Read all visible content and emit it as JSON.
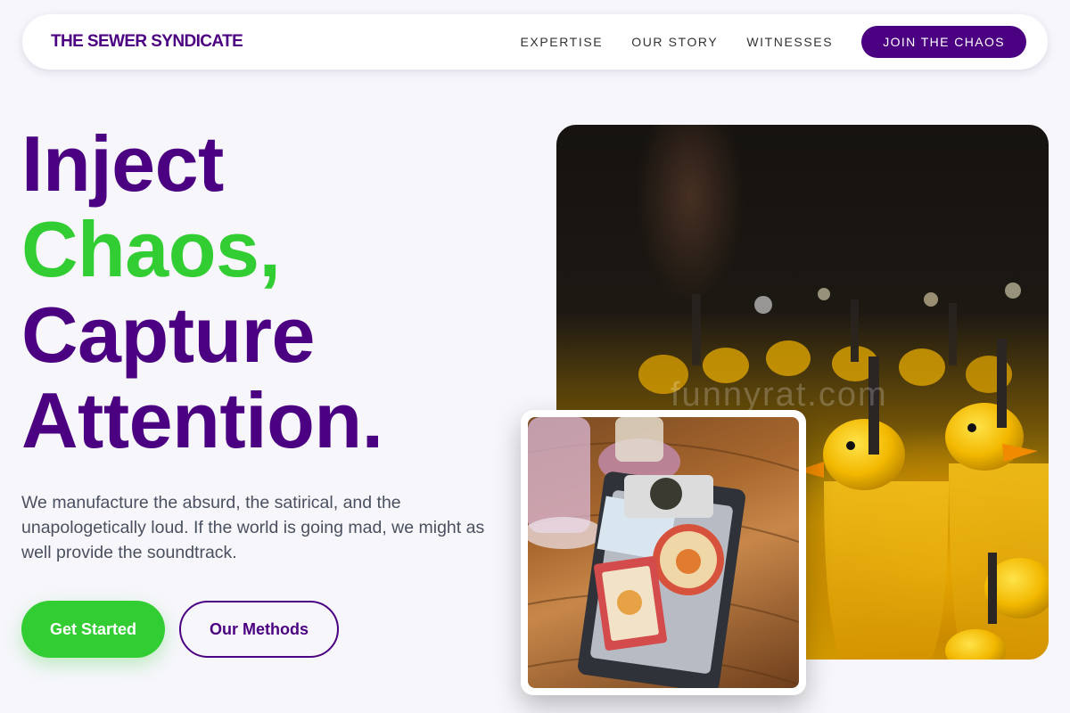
{
  "brand": {
    "name": "THE SEWER SYNDICATE"
  },
  "nav": {
    "links": [
      {
        "label": "EXPERTISE"
      },
      {
        "label": "OUR STORY"
      },
      {
        "label": "WITNESSES"
      }
    ],
    "cta_label": "JOIN THE CHAOS"
  },
  "hero": {
    "headline": {
      "line1": "Inject",
      "line2": "Chaos,",
      "line3": "Capture",
      "line4": "Attention."
    },
    "subtext": "We manufacture the absurd, the satirical, and the unapologetically loud. If the world is going mad, we might as well provide the soundtrack.",
    "primary_button": "Get Started",
    "secondary_button": "Our Methods",
    "image_watermark": "funnyrat.com"
  },
  "colors": {
    "brand_purple": "#4b0082",
    "accent_green": "#32cd32",
    "background": "#f6f6fb"
  }
}
